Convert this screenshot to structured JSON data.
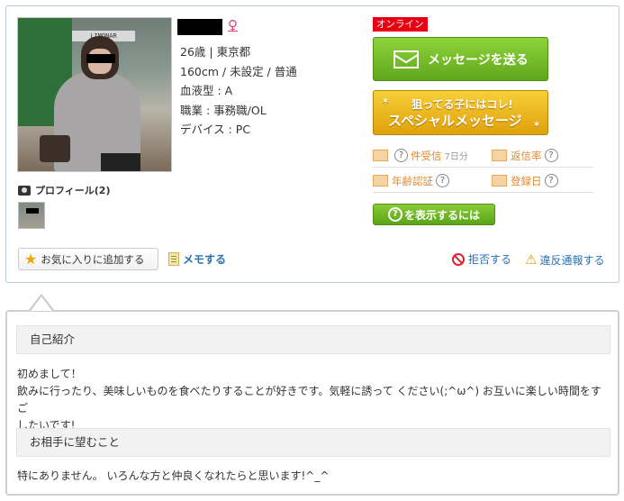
{
  "profile": {
    "age_location": "26歳 | 東京都",
    "body": "160cm / 未設定 / 普通",
    "blood": "血液型 : A",
    "job": "職業 : 事務職/OL",
    "device": "デバイス : PC",
    "gender_symbol": "♀"
  },
  "photos": {
    "label": "プロフィール(2)"
  },
  "actions": {
    "favorite": "お気に入りに追加する",
    "memo": "メモする",
    "reject": "拒否する",
    "report": "違反通報する"
  },
  "right": {
    "online": "オンライン",
    "send_message": "メッセージを送る",
    "special_line1": "狙ってる子にはコレ!",
    "special_line2": "スペシャルメッセージ",
    "received_q": "?",
    "received_label": "件受信",
    "received_period": "7日分",
    "reply_rate_label": "返信率",
    "reply_q": "?",
    "age_verify_label": "年齢認証",
    "age_q": "?",
    "registered_label": "登録日",
    "reg_q": "?",
    "show_q": "?",
    "show_button": "を表示するには"
  },
  "intro": {
    "self_title": "自己紹介",
    "self_line1": "初めまして！",
    "self_line2": "飲みに行ったり、美味しいものを食べたりすることが好きです。気軽に誘って ください(;^ω^) お互いに楽しい時間をすご",
    "self_line3": "したいです!",
    "partner_title": "お相手に望むこと",
    "partner_text": "特にありません。 いろんな方と仲良くなれたらと思います!^_^"
  },
  "colors": {
    "green": "#6bb523",
    "gold": "#e8b01a",
    "online_red": "#e60012",
    "link_blue": "#2a6fb4",
    "orange": "#e58a2e"
  }
}
